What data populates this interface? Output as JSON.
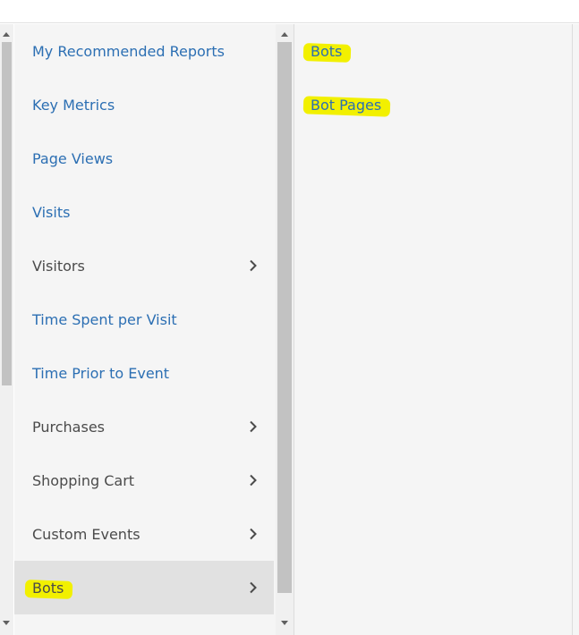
{
  "menu": {
    "items": [
      {
        "label": "My Recommended Reports",
        "type": "link"
      },
      {
        "label": "Key Metrics",
        "type": "link"
      },
      {
        "label": "Page Views",
        "type": "link"
      },
      {
        "label": "Visits",
        "type": "link"
      },
      {
        "label": "Visitors",
        "type": "submenu"
      },
      {
        "label": "Time Spent per Visit",
        "type": "link"
      },
      {
        "label": "Time Prior to Event",
        "type": "link"
      },
      {
        "label": "Purchases",
        "type": "submenu"
      },
      {
        "label": "Shopping Cart",
        "type": "submenu"
      },
      {
        "label": "Custom Events",
        "type": "submenu"
      },
      {
        "label": "Bots",
        "type": "submenu",
        "selected": true
      }
    ]
  },
  "submenu": {
    "items": [
      {
        "label": "Bots"
      },
      {
        "label": "Bot Pages"
      }
    ]
  },
  "colors": {
    "link": "#2c6fb3",
    "text": "#4b4b4b",
    "selected_bg": "#e1e1e1",
    "highlight": "#f2f000"
  }
}
